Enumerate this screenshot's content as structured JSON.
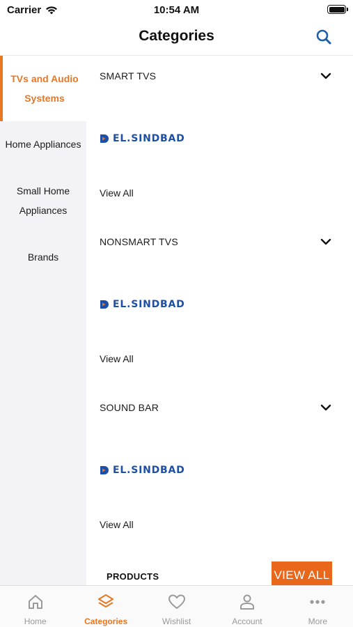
{
  "status_bar": {
    "carrier": "Carrier",
    "time": "10:54 AM",
    "battery_level": 1.0
  },
  "header": {
    "title": "Categories",
    "search_icon": "search-icon"
  },
  "colors": {
    "accent": "#e87722",
    "button": "#e8671b",
    "sidebar_bg": "#f2f2f7",
    "header_icon": "#1d5fa8",
    "logo": "#1c4fa8",
    "inactive": "#9a9a9a"
  },
  "sidebar": {
    "items": [
      {
        "label": "TVs and Audio Systems",
        "active": true
      },
      {
        "label": "Home Appliances",
        "active": false
      },
      {
        "label": "Small Home Appliances",
        "active": false
      },
      {
        "label": "Brands",
        "active": false
      }
    ]
  },
  "content": {
    "sections": [
      {
        "title": "SMART TVS",
        "brand": "EL.SINDBAD",
        "view_all": "View All"
      },
      {
        "title": "NONSMART TVS",
        "brand": "EL.SINDBAD",
        "view_all": "View All"
      },
      {
        "title": "SOUND BAR",
        "brand": "EL.SINDBAD",
        "view_all": "View All"
      }
    ],
    "products": {
      "title": "PRODUCTS",
      "button": "VIEW ALL"
    }
  },
  "tab_bar": {
    "tabs": [
      {
        "label": "Home",
        "icon": "home-icon",
        "active": false
      },
      {
        "label": "Categories",
        "icon": "layers-icon",
        "active": true
      },
      {
        "label": "Wishlist",
        "icon": "heart-icon",
        "active": false
      },
      {
        "label": "Account",
        "icon": "person-icon",
        "active": false
      },
      {
        "label": "More",
        "icon": "more-dots-icon",
        "active": false
      }
    ]
  }
}
